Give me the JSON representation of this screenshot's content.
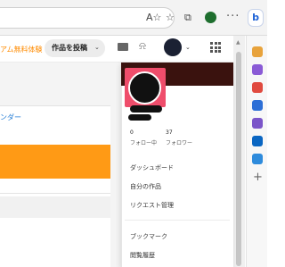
{
  "browser": {
    "reader_icon": "A☆",
    "favorite_icon": "☆",
    "collections_icon": "⧉",
    "more_label": "···",
    "bing_label": "b"
  },
  "sidebar": {
    "plus_label": "+",
    "icon_colors": [
      "#e8a33c",
      "#8a5bd6",
      "#e04a3f",
      "#2d6fd6",
      "#7b55c9",
      "#0a66c2",
      "#2e8bdc"
    ]
  },
  "header": {
    "promo_text": "アム無料体験",
    "post_button": "作品を投稿",
    "chevron": "⌄",
    "bell_icon": "⍾"
  },
  "left_panel": {
    "tab_fragment": "ンダー"
  },
  "account_menu": {
    "following_count": "0",
    "following_label": "フォロー中",
    "followers_count": "37",
    "followers_label": "フォロワー",
    "items": [
      "ダッシュボード",
      "自分の作品",
      "リクエスト管理",
      "ブックマーク",
      "閲覧履歴"
    ]
  },
  "colors": {
    "accent_orange": "#ff8b00",
    "cover": "#3a120e",
    "avatar_frame": "#ef4d6b"
  }
}
